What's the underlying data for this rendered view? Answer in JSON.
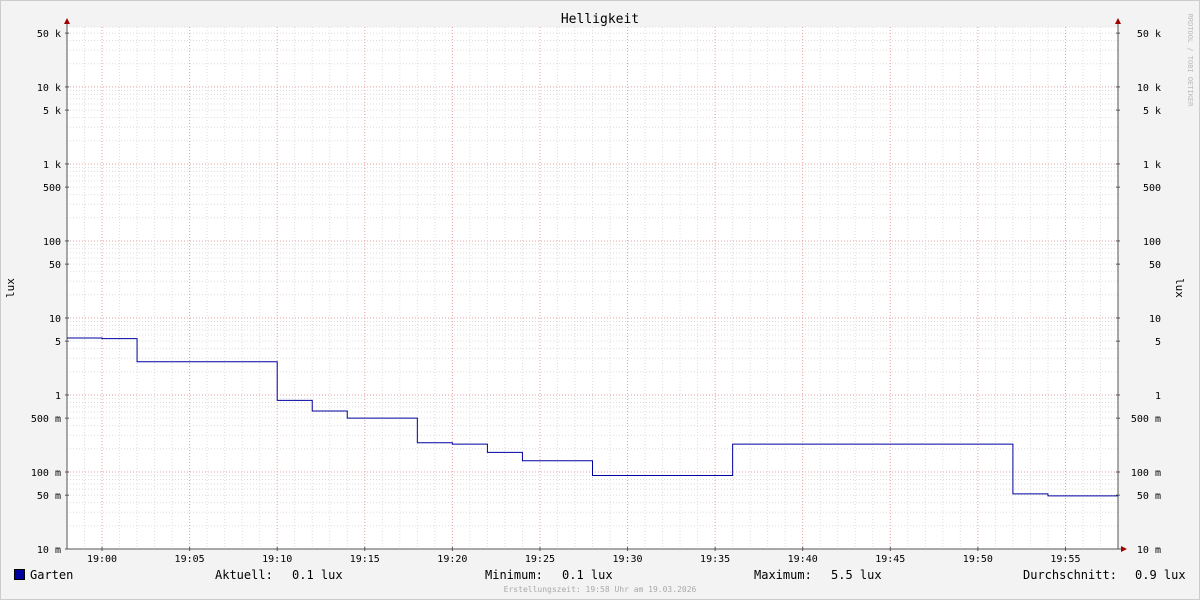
{
  "chart_data": {
    "type": "line",
    "title": "Helligkeit",
    "ylabel": "lux",
    "ylabel_right": "lux",
    "y_scale": "log",
    "ylim": [
      10,
      60000
    ],
    "x_start": "18:58:00",
    "x_end": "19:58:00",
    "x_ticks": [
      "19:00",
      "19:05",
      "19:10",
      "19:15",
      "19:20",
      "19:25",
      "19:30",
      "19:35",
      "19:40",
      "19:45",
      "19:50",
      "19:55"
    ],
    "y_ticks": [
      {
        "value": 50000,
        "label": "50 k"
      },
      {
        "value": 10000,
        "label": "10 k"
      },
      {
        "value": 5000,
        "label": "5 k"
      },
      {
        "value": 1000,
        "label": "1 k"
      },
      {
        "value": 500,
        "label": "500"
      },
      {
        "value": 100,
        "label": "100"
      },
      {
        "value": 50,
        "label": "50"
      },
      {
        "value": 10,
        "label": "10"
      },
      {
        "value": 5,
        "label": "5"
      },
      {
        "value": 1,
        "label": "1"
      },
      {
        "value": 0.5,
        "label": "500 m"
      },
      {
        "value": 0.1,
        "label": "100 m"
      },
      {
        "value": 0.05,
        "label": "50 m"
      },
      {
        "value": 0.01,
        "label": "10 m"
      }
    ],
    "series": [
      {
        "name": "Garten",
        "color": "#0000a0",
        "step": true,
        "points": [
          [
            "18:58:00",
            5.5
          ],
          [
            "19:00:00",
            5.4
          ],
          [
            "19:02:00",
            2.7
          ],
          [
            "19:10:00",
            0.85
          ],
          [
            "19:12:00",
            0.62
          ],
          [
            "19:14:00",
            0.5
          ],
          [
            "19:18:00",
            0.24
          ],
          [
            "19:20:00",
            0.23
          ],
          [
            "19:22:00",
            0.18
          ],
          [
            "19:24:00",
            0.14
          ],
          [
            "19:28:00",
            0.09
          ],
          [
            "19:36:00",
            0.23
          ],
          [
            "19:52:00",
            0.052
          ],
          [
            "19:54:00",
            0.049
          ],
          [
            "19:58:00",
            0.049
          ]
        ]
      }
    ],
    "grid": true,
    "watermark": "RRDTOOL / TOBI OETIKER"
  },
  "legend": {
    "series_name": "Garten",
    "current_label": "Aktuell:",
    "current_value": "0.1 lux",
    "min_label": "Minimum:",
    "min_value": "0.1 lux",
    "max_label": "Maximum:",
    "max_value": "5.5 lux",
    "avg_label": "Durchschnitt:",
    "avg_value": "0.9 lux"
  },
  "footer": "Erstellungszeit: 19:58 Uhr am 19.03.2026"
}
